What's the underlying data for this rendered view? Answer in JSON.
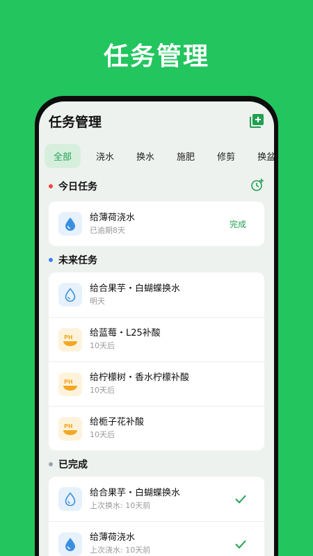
{
  "promo": {
    "title": "任务管理"
  },
  "header": {
    "title": "任务管理",
    "add_icon": "add-task-icon"
  },
  "tabs": [
    {
      "label": "全部",
      "active": true
    },
    {
      "label": "浇水",
      "active": false
    },
    {
      "label": "换水",
      "active": false
    },
    {
      "label": "施肥",
      "active": false
    },
    {
      "label": "修剪",
      "active": false
    },
    {
      "label": "换盆",
      "active": false
    }
  ],
  "sections": {
    "today": {
      "title": "今日任务",
      "dot_color": "#ef4444",
      "tasks": [
        {
          "name": "给薄荷浇水",
          "sub": "已逾期8天",
          "action": "完成",
          "icon": "water-drop-icon"
        }
      ]
    },
    "future": {
      "title": "未来任务",
      "dot_color": "#3b82f6",
      "tasks": [
        {
          "name": "给合果芋・白蝴蝶换水",
          "sub": "明天",
          "icon": "water-drop-outline-icon"
        },
        {
          "name": "给蓝莓・L25补酸",
          "sub": "10天后",
          "icon": "ph-icon",
          "icon_text": "PH"
        },
        {
          "name": "给柠檬树・香水柠檬补酸",
          "sub": "10天后",
          "icon": "ph-icon",
          "icon_text": "PH"
        },
        {
          "name": "给栀子花补酸",
          "sub": "10天后",
          "icon": "ph-icon",
          "icon_text": "PH"
        }
      ]
    },
    "completed": {
      "title": "已完成",
      "dot_color": "#9ca3af",
      "tasks": [
        {
          "name": "给合果芋・白蝴蝶换水",
          "sub": "上次换水: 10天前",
          "icon": "water-drop-outline-icon"
        },
        {
          "name": "给薄荷浇水",
          "sub": "上次浇水: 10天前",
          "icon": "water-drop-icon"
        }
      ]
    }
  },
  "colors": {
    "brand": "#22c55e",
    "accent": "#22a052",
    "water": "#3b8fe0",
    "ph": "#f5a623"
  }
}
